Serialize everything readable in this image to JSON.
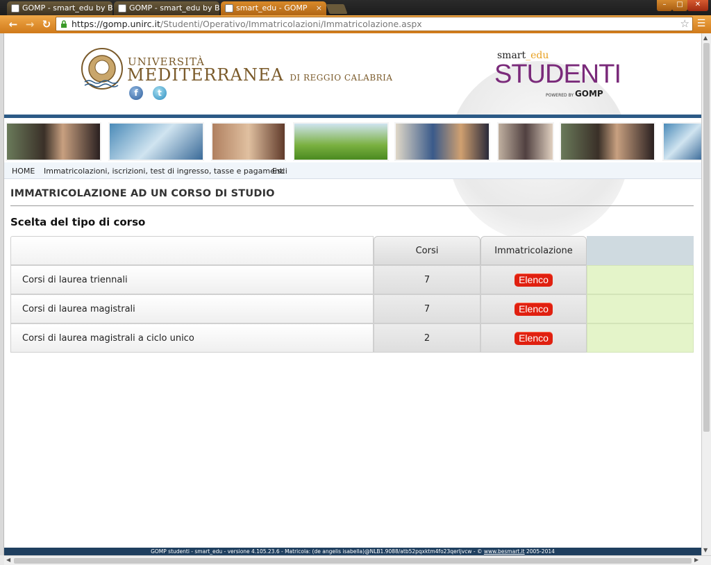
{
  "browser": {
    "tabs": [
      {
        "title": "GOMP - smart_edu by Be",
        "active": false
      },
      {
        "title": "GOMP - smart_edu by Be",
        "active": false
      },
      {
        "title": "smart_edu - GOMP",
        "active": true
      }
    ],
    "url_host": "https://gomp.unirc.it",
    "url_path": "/Studenti/Operativo/Immatricolazioni/Immatricolazione.aspx",
    "close_glyph": "×"
  },
  "header": {
    "uni_line1": "UNIVERSITÀ",
    "uni_line2": "MEDITERRANEA",
    "uni_line2_suffix": "DI REGGIO CALABRIA",
    "brand_top": "smart",
    "brand_top_edu": "_edu",
    "brand_main": "STUDENTI",
    "brand_sub": "POWERED BY",
    "brand_sub_logo": "GOMP"
  },
  "nav": {
    "home": "HOME",
    "immatricolazioni": "Immatricolazioni, iscrizioni, test di ingresso, tasse e pagamenti",
    "esci": "Esci"
  },
  "page": {
    "title": "IMMATRICOLAZIONE AD UN CORSO DI STUDIO",
    "subtitle": "Scelta del tipo di corso"
  },
  "table": {
    "headers": {
      "corsi": "Corsi",
      "immatricolazione": "Immatricolazione"
    },
    "rows": [
      {
        "label": "Corsi di laurea triennali",
        "count": "7",
        "action": "Elenco"
      },
      {
        "label": "Corsi di laurea magistrali",
        "count": "7",
        "action": "Elenco"
      },
      {
        "label": "Corsi di laurea magistrali a ciclo unico",
        "count": "2",
        "action": "Elenco"
      }
    ]
  },
  "footer": {
    "text": "GOMP studenti - smart_edu - versione 4.105.23.6 - Matricola: (de angelis isabella)@NLB1.9088/atb52pqxktm4fo23qerljvcw - ©",
    "link": "www.besmart.it",
    "years": "2005-2014"
  },
  "colors": {
    "accent_orange": "#d07a1a",
    "header_blue": "#2c5a86",
    "elenco_red": "#e02010",
    "fill_green": "#e4f4c9",
    "brand_purple": "#7a2a7a"
  }
}
